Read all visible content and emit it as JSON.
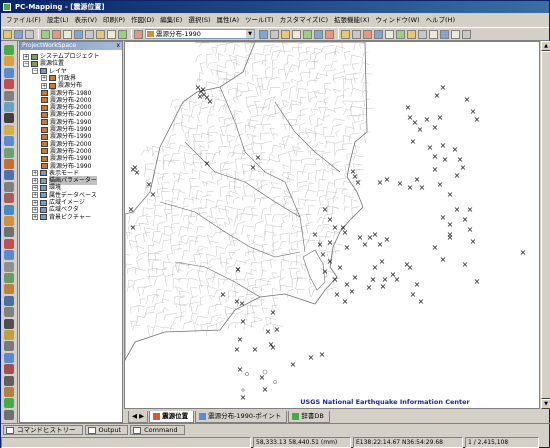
{
  "window": {
    "title": "PC-Mapping - [震源位置]"
  },
  "menu": [
    "ファイル(F)",
    "設定(L)",
    "表示(V)",
    "印刷(P)",
    "作図(D)",
    "編集(E)",
    "選択(S)",
    "属性(A)",
    "ツール(T)",
    "カスタマイズ(C)",
    "拡張機能(X)",
    "ウィンドウ(W)",
    "ヘルプ(H)"
  ],
  "toolbar": {
    "layer_select": "震源分布-1990"
  },
  "workspace": {
    "title": "ProjectWorkSpace",
    "items": [
      {
        "label": "システムプロジェクト",
        "level": 0
      },
      {
        "label": "震源位置",
        "level": 0
      },
      {
        "label": "レイヤ",
        "level": 1
      },
      {
        "label": "行政界",
        "level": 2
      },
      {
        "label": "震源分布",
        "level": 2
      },
      {
        "label": "震源分布-1980",
        "level": 2
      },
      {
        "label": "震源分布-2000",
        "level": 2
      },
      {
        "label": "震源分布-2000",
        "level": 2
      },
      {
        "label": "震源分布-2000",
        "level": 2
      },
      {
        "label": "震源分布-1990",
        "level": 2
      },
      {
        "label": "震源分布-1990",
        "level": 2
      },
      {
        "label": "震源分布-1990",
        "level": 2
      },
      {
        "label": "震源分布-2000",
        "level": 2
      },
      {
        "label": "震源分布-2000",
        "level": 2
      },
      {
        "label": "震源分布-1990",
        "level": 2
      },
      {
        "label": "震源分布-1990",
        "level": 2
      },
      {
        "label": "表示モード",
        "level": 1
      },
      {
        "label": "描画パラメーター",
        "level": 1,
        "selected": true
      },
      {
        "label": "環境",
        "level": 1
      },
      {
        "label": "属性データベース",
        "level": 1
      },
      {
        "label": "広域イメージ",
        "level": 1
      },
      {
        "label": "広域ベクタ",
        "level": 1
      },
      {
        "label": "背景ピクチャー",
        "level": 1
      }
    ]
  },
  "map": {
    "credit": "USGS National Earthquake Information Center",
    "credit_color": "#1a2a9a",
    "marker": "×"
  },
  "map_tabs": [
    "震源位置",
    "震源分布-1990-ポイント",
    "辞書DB"
  ],
  "bottom_tabs": [
    "コマンドヒストリー",
    "Output",
    "Command"
  ],
  "status": {
    "xy": "58,333.13 58,440.51 (mm)",
    "lonlat": "E138:22:14.67 N36:54:29.68",
    "scale": "1 / 2,415,108"
  }
}
